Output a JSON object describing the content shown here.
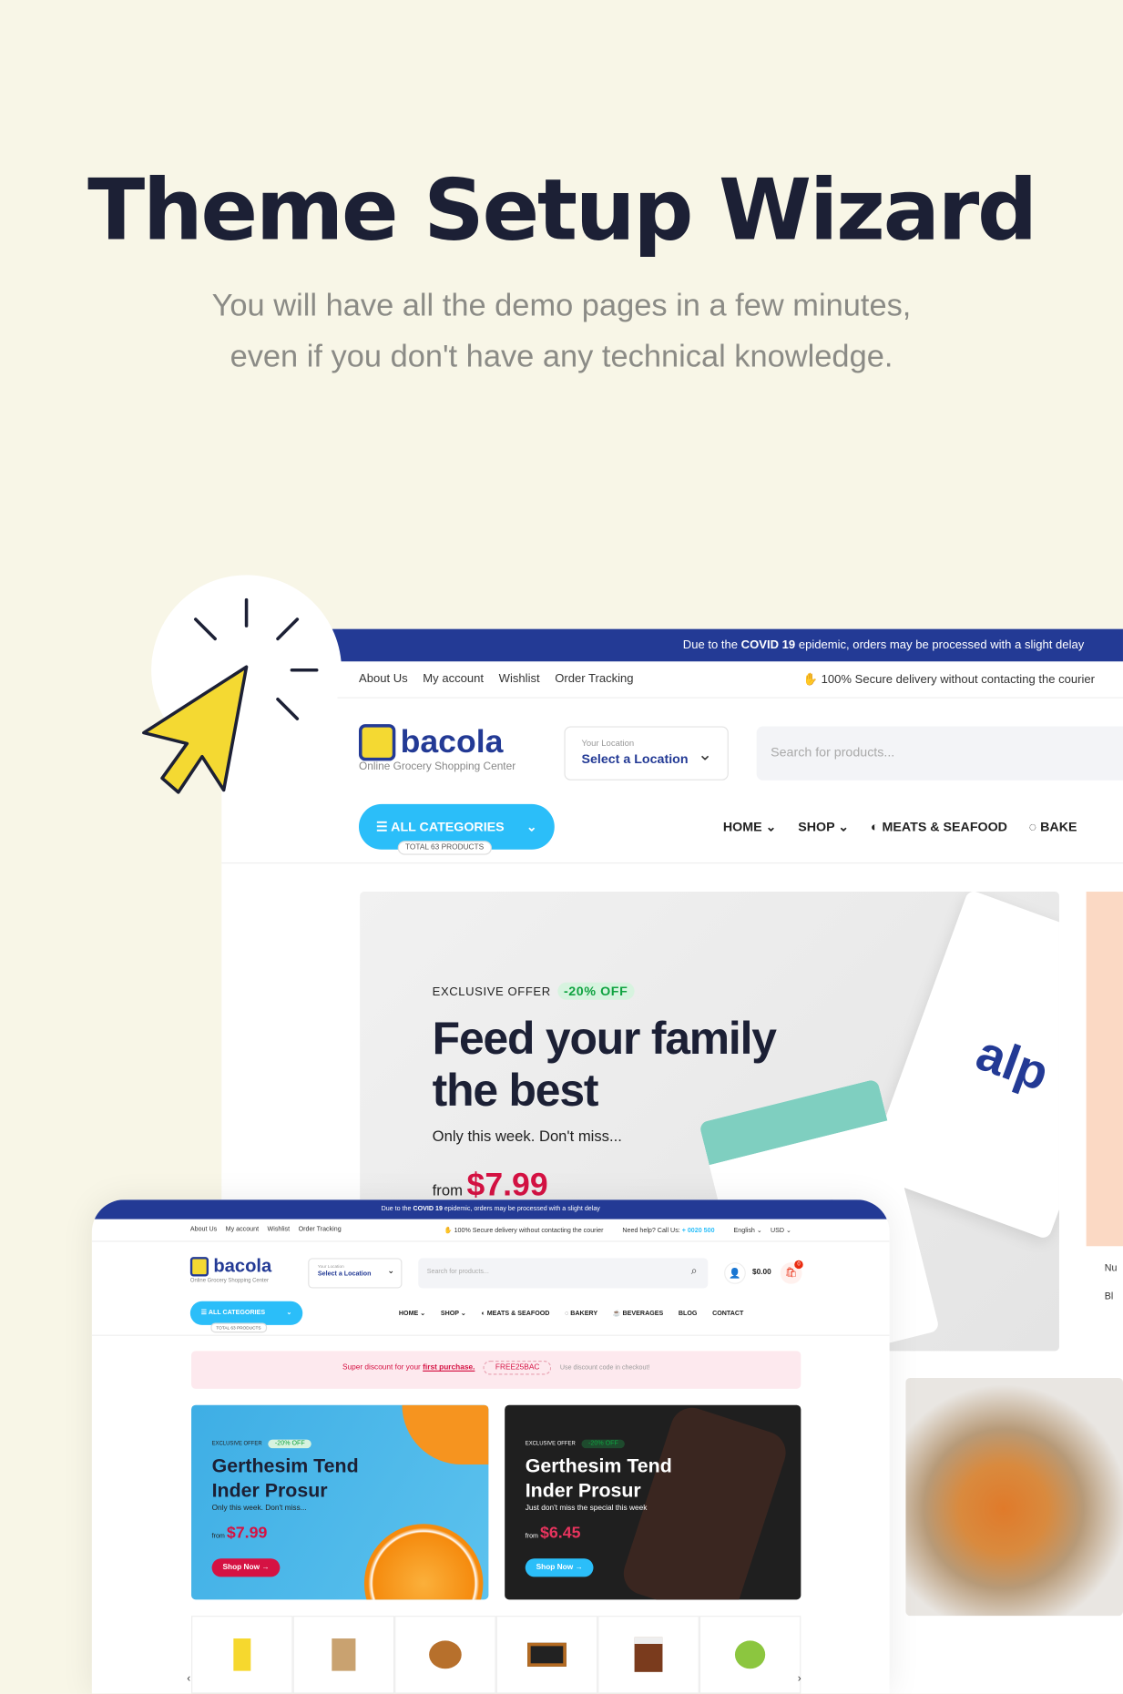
{
  "page": {
    "title": "Theme Setup Wizard",
    "subtitle_line1": "You will have all the demo pages in a few minutes,",
    "subtitle_line2": "even if you don't have any technical knowledge."
  },
  "colors": {
    "background": "#f8f6e7",
    "brand_blue": "#233a95",
    "accent_cyan": "#2bbef9",
    "price_red": "#d51243",
    "cursor_yellow": "#f4d932"
  },
  "back": {
    "notice_prefix": "Due to the ",
    "notice_bold": "COVID 19",
    "notice_suffix": " epidemic, orders may be processed with a slight delay",
    "links": [
      "About Us",
      "My account",
      "Wishlist",
      "Order Tracking"
    ],
    "secure": "100% Secure delivery without contacting the courier",
    "logo": "bacola",
    "tagline": "Online Grocery Shopping Center",
    "location_label": "Your Location",
    "location_value": "Select a Location",
    "search_placeholder": "Search for products...",
    "all_categories": "ALL CATEGORIES",
    "total_products": "TOTAL 63 PRODUCTS",
    "nav": [
      "HOME",
      "SHOP",
      "MEATS & SEAFOOD",
      "BAKE"
    ],
    "hero": {
      "exclusive": "EXCLUSIVE OFFER",
      "discount": "-20% OFF",
      "headline1": "Feed your family",
      "headline2": "the best",
      "sub": "Only this week. Don't miss...",
      "from": "from",
      "price": "$7.99"
    },
    "side_text": [
      "Nu",
      "Bl"
    ]
  },
  "front": {
    "notice_prefix": "Due to the ",
    "notice_bold": "COVID 19",
    "notice_suffix": " epidemic, orders may be processed with a slight delay",
    "links": [
      "About Us",
      "My account",
      "Wishlist",
      "Order Tracking"
    ],
    "secure": "100% Secure delivery without contacting the courier",
    "help": "Need help? Call Us: ",
    "phone": "+ 0020 500",
    "language": "English",
    "currency": "USD",
    "logo": "bacola",
    "tagline": "Online Grocery Shopping Center",
    "location_label": "Your Location",
    "location_value": "Select a Location",
    "search_placeholder": "Search for products...",
    "cart_total": "$0.00",
    "cart_count": "0",
    "all_categories": "ALL CATEGORIES",
    "total_products": "TOTAL 63 PRODUCTS",
    "nav": [
      "HOME",
      "SHOP",
      "MEATS & SEAFOOD",
      "BAKERY",
      "BEVERAGES",
      "BLOG",
      "CONTACT"
    ],
    "banner": {
      "text": "Super discount for your ",
      "link": "first purchase.",
      "code": "FREE25BAC",
      "note": "Use discount code in checkout!"
    },
    "cards": [
      {
        "exclusive": "EXCLUSIVE OFFER",
        "discount": "-20% OFF",
        "title1": "Gerthesim Tend",
        "title2": "Inder Prosur",
        "sub": "Only this week. Don't miss...",
        "from": "from",
        "price": "$7.99",
        "button": "Shop Now →"
      },
      {
        "exclusive": "EXCLUSIVE OFFER",
        "discount": "-20% OFF",
        "title1": "Gerthesim Tend",
        "title2": "Inder Prosur",
        "sub": "Just don't miss the special this week",
        "from": "from",
        "price": "$6.45",
        "button": "Shop Now →"
      }
    ]
  }
}
